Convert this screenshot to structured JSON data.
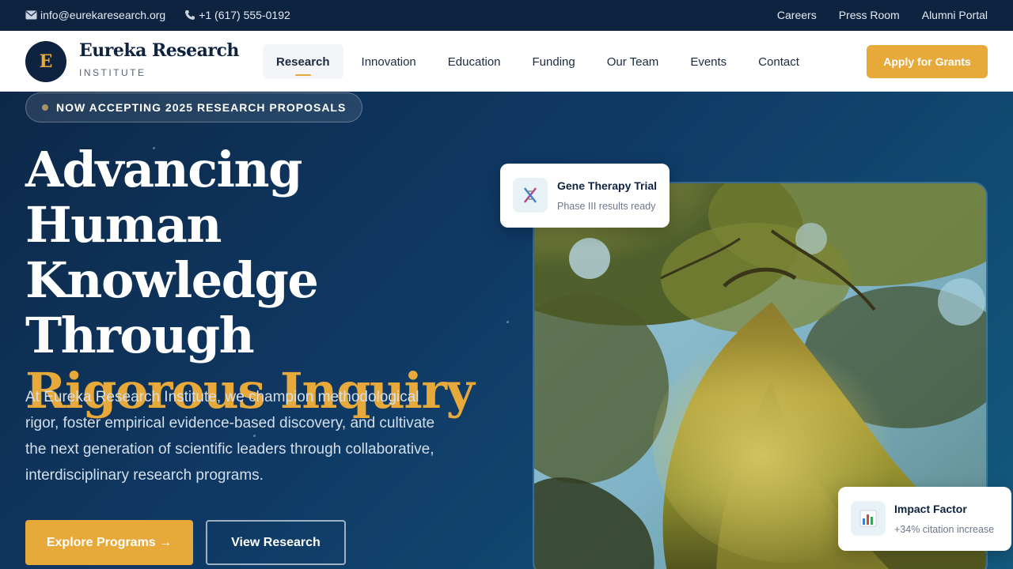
{
  "topbar": {
    "email": "info@eurekaresearch.org",
    "phone": "+1 (617) 555-0192",
    "email_icon": "envelope-icon",
    "phone_icon": "phone-icon",
    "links": [
      "Careers",
      "Press Room",
      "Alumni Portal"
    ]
  },
  "header": {
    "logo_letter": "E",
    "logo_name": "Eureka Research",
    "logo_sub": "INSTITUTE",
    "nav": [
      "Research",
      "Innovation",
      "Education",
      "Funding",
      "Our Team",
      "Events",
      "Contact"
    ],
    "active_nav": "Research",
    "cta": "Apply for Grants"
  },
  "hero": {
    "badge": "NOW ACCEPTING 2025 RESEARCH PROPOSALS",
    "headline_plain": "Advancing Human Knowledge Through",
    "headline_accent": "Rigorous Inquiry",
    "lead": "At Eureka Research Institute, we champion methodological rigor, foster empirical evidence-based discovery, and cultivate the next generation of scientific leaders through collaborative, interdisciplinary research programs.",
    "primary_button": "Explore Programs →",
    "secondary_button": "View Research"
  },
  "cards": {
    "gene": {
      "icon": "dna-icon",
      "title": "Gene Therapy Trial",
      "subtitle": "Phase III results ready"
    },
    "impact": {
      "icon": "bar-chart-icon",
      "title": "Impact Factor",
      "subtitle": "+34% citation increase"
    }
  },
  "colors": {
    "accent": "#e6a93a",
    "navy": "#0e2340",
    "hero_start": "#0e2848",
    "hero_end": "#135a7e"
  }
}
